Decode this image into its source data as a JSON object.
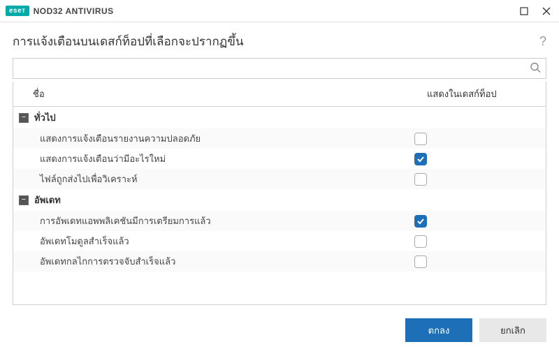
{
  "brand": {
    "logo": "eseт",
    "product": "NOD32 ANTIVIRUS"
  },
  "page_title": "การแจ้งเตือนบนเดสก์ท็อปที่เลือกจะปรากฏขึ้น",
  "search": {
    "placeholder": ""
  },
  "columns": {
    "name": "ชื่อ",
    "show": "แสดงในเดสก์ท็อป"
  },
  "groups": [
    {
      "label": "ทั่วไป",
      "items": [
        {
          "label": "แสดงการแจ้งเตือนรายงานความปลอดภัย",
          "checked": false
        },
        {
          "label": "แสดงการแจ้งเตือนว่ามีอะไรใหม่",
          "checked": true
        },
        {
          "label": "ไฟล์ถูกส่งไปเพื่อวิเคราะห์",
          "checked": false
        }
      ]
    },
    {
      "label": "อัพเดท",
      "items": [
        {
          "label": "การอัพเดทแอพพลิเคชันมีการเตรียมการแล้ว",
          "checked": true
        },
        {
          "label": "อัพเดทโมดูลสำเร็จแล้ว",
          "checked": false
        },
        {
          "label": "อัพเดทกลไกการตรวจจับสำเร็จแล้ว",
          "checked": false
        }
      ]
    }
  ],
  "buttons": {
    "ok": "ตกลง",
    "cancel": "ยกเลิก"
  }
}
